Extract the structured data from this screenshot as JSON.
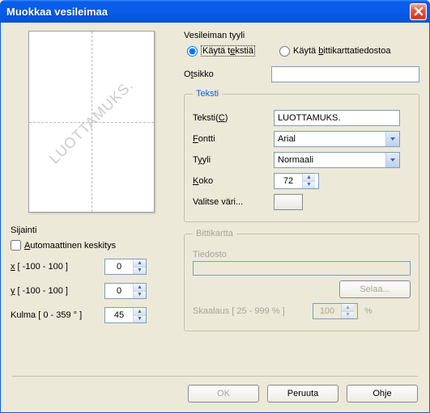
{
  "window": {
    "title": "Muokkaa vesileimaa"
  },
  "preview": {
    "watermark": "LUOTTAMUKS."
  },
  "sijainti": {
    "label": "Sijainti",
    "auto": "Automaattinen keskitys",
    "x_label": "x [ -100  -  100 ]",
    "y_label": "y [ -100  -  100 ]",
    "angle_label": "Kulma [ 0 - 359 ° ]",
    "x": "0",
    "y": "0",
    "angle": "45"
  },
  "style": {
    "label": "Vesileiman tyyli",
    "opt_text": "Käytä tekstiä",
    "opt_bitmap": "Käytä bittikarttatiedostoa"
  },
  "otsikko": {
    "label": "Otsikko",
    "value": ""
  },
  "teksti": {
    "legend": "Teksti",
    "text_label": "Teksti(C)",
    "text_value": "LUOTTAMUKS.",
    "font_label": "Fontti",
    "font_value": "Arial",
    "style_label": "Tyyli",
    "style_value": "Normaali",
    "size_label": "Koko",
    "size_value": "72",
    "color_label": "Valitse väri..."
  },
  "bitmap": {
    "legend": "Bittikartta",
    "file_label": "Tiedosto",
    "file_value": "",
    "browse": "Selaa...",
    "scale_label": "Skaalaus [ 25 - 999 % ]",
    "scale_value": "100",
    "percent": "%"
  },
  "buttons": {
    "ok": "OK",
    "cancel": "Peruuta",
    "help": "Ohje"
  }
}
